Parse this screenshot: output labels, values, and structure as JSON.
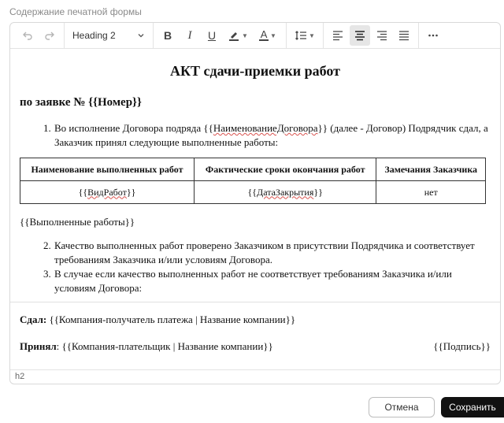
{
  "field_label": "Содержание печатной формы",
  "toolbar": {
    "undo_icon": "undo-icon",
    "redo_icon": "redo-icon",
    "heading_value": "Heading 2",
    "bold": "B",
    "italic": "I",
    "underline": "U",
    "font_color_letter": "A"
  },
  "document": {
    "title": "АКТ сдачи-приемки работ",
    "subtitle": "по заявке № {{Номер}}",
    "p1_num": "1.",
    "p1_a": "Во исполнение Договора подряда {{",
    "p1_link": "НаименованиеДоговора",
    "p1_b": "}} (далее - Договор) Подрядчик сдал, а Заказчик принял следующие выполненные работы:",
    "table": {
      "headers": [
        "Наименование выполненных работ",
        "Фактические сроки окончания работ",
        "Замечания Заказчика"
      ],
      "row": {
        "c1_a": "{{",
        "c1_link": "ВидРабот",
        "c1_b": "}}",
        "c2_a": "{{",
        "c2_link": "ДатаЗакрытия",
        "c2_b": "}}",
        "c3": "нет"
      }
    },
    "completed_works": "{{Выполненные работы}}",
    "p2_num": "2.",
    "p2": "Качество выполненных работ проверено Заказчиком в присутствии Подрядчика и соответствует требованиям Заказчика и/или условиям Договора.",
    "p3_num": "3.",
    "p3": "В случае если качество выполненных работ не соответствует требованиям Заказчика и/или условиям Договора:",
    "handed_label": "Сдал:",
    "handed_value": "{{Компания-получатель платежа | Название компании}}",
    "accepted_label": "Принял",
    "accepted_value": ": {{Компания-плательщик | Название компании}}",
    "signature": "{{Подпись}}"
  },
  "status_bar": "h2",
  "buttons": {
    "cancel": "Отмена",
    "save": "Сохранить"
  },
  "colors": {
    "save_bg": "#111111",
    "spellcheck": "#d9534f",
    "active_button_bg": "#e6e6e6"
  }
}
